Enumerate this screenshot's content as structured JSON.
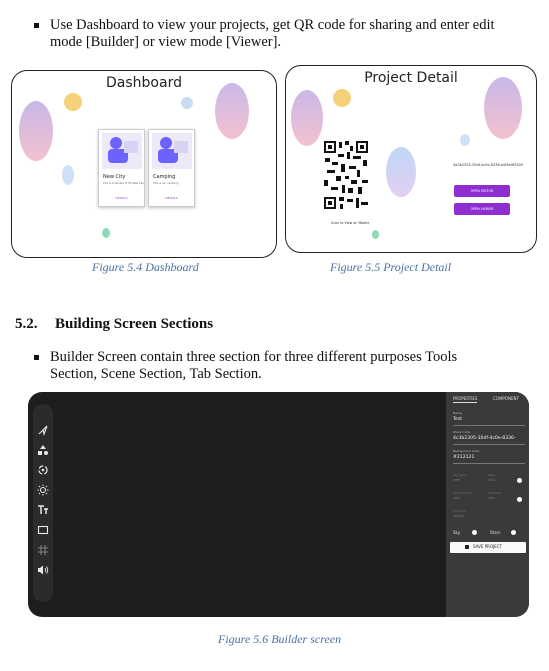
{
  "bullet1": {
    "line1": "Use Dashboard to view your projects, get QR code for sharing and enter edit",
    "line2": "mode [Builder] or view mode [Viewer]."
  },
  "dashboard": {
    "title": "Dashboard",
    "cards": [
      {
        "name": "New City",
        "desc": "This is a sample of 3D New City",
        "link": "DETAILS"
      },
      {
        "name": "Camping",
        "desc": "This is our camping",
        "link": "DETAILS"
      }
    ],
    "caption": "Figure 5.4 Dashboard"
  },
  "project_detail": {
    "title": "Project Detail",
    "share_code": "4a3b2305-30df-4c0e-8336-a0f8e9f5020",
    "buttons": [
      "OPEN EDITOR",
      "OPEN VIEWER"
    ],
    "scan_text": "Scan to View on Mobile",
    "caption": "Figure 5.5 Project Detail"
  },
  "section": {
    "number": "5.2.",
    "title": "Building Screen Sections"
  },
  "bullet2": {
    "line1": "Builder Screen contain three section for three different purposes Tools",
    "line2": "Section, Scene Section, Tab Section."
  },
  "builder": {
    "tools": [
      "cursor-icon",
      "shapes-icon",
      "rotate-icon",
      "light-icon",
      "text-icon",
      "frame-icon",
      "grid-icon",
      "sound-icon"
    ],
    "tabs": [
      "PROPERTIES",
      "COMPONENT"
    ],
    "fields": [
      {
        "label": "Name",
        "value": "Test"
      },
      {
        "label": "Share Code",
        "value": "4c3b2305-30df-4c0e-8336-"
      },
      {
        "label": "Background Color",
        "value": "#212121"
      }
    ],
    "dim_fields": [
      {
        "label": "Sky Color",
        "value": "#fffff"
      },
      {
        "label": "Stars",
        "value": "0000"
      },
      {
        "label": "Ground Color",
        "value": "0000"
      },
      {
        "label": "Grid Color",
        "value": "0000"
      },
      {
        "label": "Fog Color",
        "value": "#00000"
      }
    ],
    "toggles": [
      "Sky",
      "Stars"
    ],
    "save_label": "SAVE PROJECT",
    "accent": "#8f2ed0",
    "caption": "Figure 5.6 Builder screen"
  }
}
